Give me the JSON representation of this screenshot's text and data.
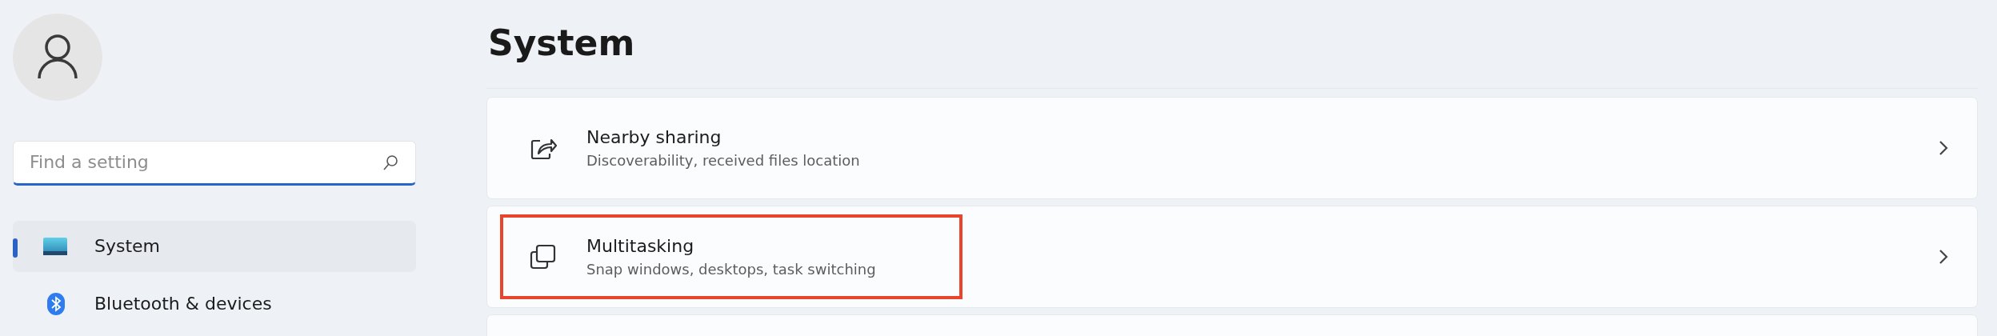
{
  "sidebar": {
    "search": {
      "placeholder": "Find a setting",
      "focused": true
    },
    "items": [
      {
        "label": "System",
        "selected": true
      },
      {
        "label": "Bluetooth & devices",
        "selected": false
      }
    ]
  },
  "page": {
    "title": "System",
    "cards": [
      {
        "title": "Nearby sharing",
        "subtitle": "Discoverability, received files location",
        "highlighted": false
      },
      {
        "title": "Multitasking",
        "subtitle": "Snap windows, desktops, task switching",
        "highlighted": true
      }
    ]
  }
}
